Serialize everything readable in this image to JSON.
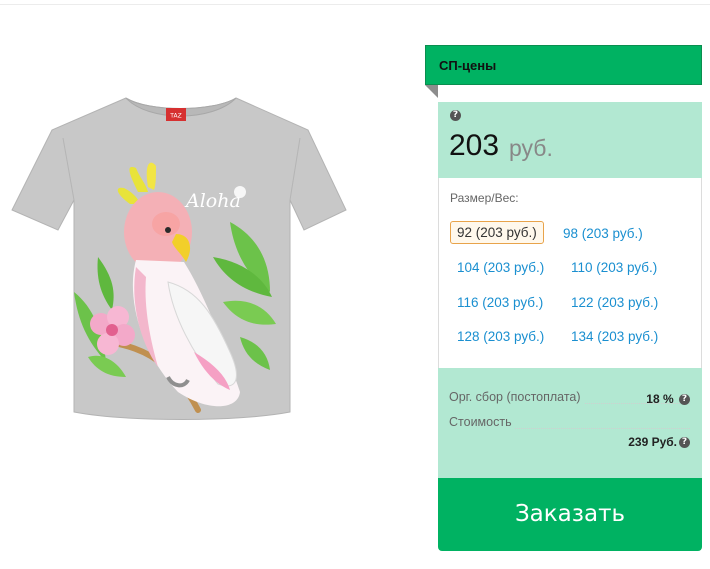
{
  "panel": {
    "title": "СП-цены",
    "help_icon": "?",
    "price_value": "203",
    "price_unit": "руб."
  },
  "sizes": {
    "label": "Размер/Вес:",
    "options": [
      {
        "label": "92 (203 руб.)",
        "selected": true
      },
      {
        "label": "98 (203 руб.)",
        "selected": false
      },
      {
        "label": "104 (203 руб.)",
        "selected": false
      },
      {
        "label": "110 (203 руб.)",
        "selected": false
      },
      {
        "label": "116 (203 руб.)",
        "selected": false
      },
      {
        "label": "122 (203 руб.)",
        "selected": false
      },
      {
        "label": "128 (203 руб.)",
        "selected": false
      },
      {
        "label": "134 (203 руб.)",
        "selected": false
      }
    ]
  },
  "fees": {
    "org_fee_label": "Орг. сбор (постоплата)",
    "org_fee_value": "18 %",
    "cost_label": "Стоимость",
    "cost_value": "239 Руб."
  },
  "order_button": "Заказать",
  "product_image": {
    "print_text": "Aloha",
    "label_text": "TAZ",
    "shirt_color": "#c8c8c8",
    "accent_color": "#00b262"
  }
}
